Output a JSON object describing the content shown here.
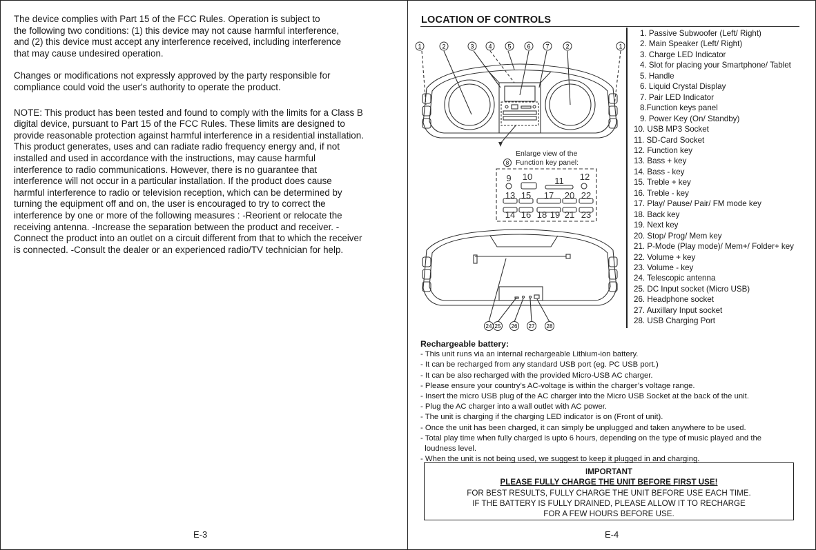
{
  "left_page": {
    "paragraphs": [
      "The device complies with Part 15 of the FCC Rules. Operation is subject to\nthe following two conditions: (1) this device may not cause harmful interference,\nand (2) this device must accept any interference received, including interference\nthat may cause undesired operation.",
      "Changes or modifications not expressly approved by the party responsible for\ncompliance could void the user's authority to operate the product.",
      "NOTE: This product has been tested and found to comply with the limits for a Class B\ndigital device, pursuant to Part 15 of the FCC Rules. These limits are designed to\nprovide reasonable protection against harmful interference in a residential installation.\nThis product generates, uses and can radiate radio frequency energy and, if not\ninstalled and used in accordance with the instructions, may cause harmful\ninterference to radio communications. However, there is no guarantee that\ninterference will not occur in a particular installation. If the product does cause\nharmful interference to radio or television reception, which can be determined by\nturning the equipment off and on, the user is encouraged to try to correct the\ninterference by one or more of the following measures : -Reorient or relocate the\nreceiving antenna. -Increase the separation between the product and receiver. -\nConnect the product into an outlet on a circuit different from that to which the receiver\nis connected. -Consult the dealer or an experienced radio/TV technician for help."
    ],
    "page_number": "E-3"
  },
  "right_page": {
    "title": "LOCATION OF CONTROLS",
    "front_callouts": [
      "1",
      "2",
      "3",
      "4",
      "5",
      "6",
      "7",
      "2",
      "1"
    ],
    "enlarge_caption_line1": "Enlarge view of the",
    "enlarge_caption_line2": "Function key panel:",
    "enlarge_callout": "8",
    "panel_labels": {
      "top": [
        "9",
        "10",
        "11",
        "12"
      ],
      "middle": [
        "13",
        "15",
        "17",
        "20",
        "22"
      ],
      "bottom": [
        "14",
        "16",
        "18",
        "19",
        "21",
        "23"
      ]
    },
    "back_callouts": [
      "24",
      "25",
      "26",
      "27",
      "28"
    ],
    "legend": [
      "1. Passive Subwoofer (Left/ Right)",
      "2. Main Speaker (Left/ Right)",
      "3. Charge LED Indicator",
      "4. Slot for placing your Smartphone/ Tablet",
      "5. Handle",
      "6. Liquid Crystal Display",
      "7. Pair LED Indicator",
      "8.Function keys panel",
      "9. Power Key (On/ Standby)",
      "10. USB MP3 Socket",
      "11. SD-Card Socket",
      "12. Function key",
      "13. Bass + key",
      "14. Bass - key",
      "15. Treble + key",
      "16. Treble - key",
      "17. Play/ Pause/ Pair/ FM mode key",
      "18. Back key",
      "19. Next key",
      "20. Stop/ Prog/ Mem key",
      "21. P-Mode (Play mode)/ Mem+/ Folder+ key",
      "22. Volume + key",
      "23. Volume - key",
      "24. Telescopic antenna",
      "25. DC Input socket (Micro USB)",
      "26. Headphone socket",
      "27. Auxillary Input socket",
      "28. USB Charging Port"
    ],
    "battery": {
      "heading": "Rechargeable battery:",
      "items": [
        "- This unit runs via an internal rechargeable Lithium-ion battery.",
        "- It can be recharged from any standard USB port (eg. PC USB port.)",
        "- It can be also recharged with the provided Micro-USB AC charger.",
        "- Please ensure your country’s AC-voltage is within the charger’s voltage range.",
        "- Insert the micro USB plug of the AC charger into the Micro USB Socket at the back of the unit.",
        "- Plug the AC charger into a wall outlet with AC power.",
        "- The unit is charging if the charging LED indicator is on (Front of unit).",
        "- Once the unit has been charged, it can simply be unplugged and taken anywhere to be used.",
        "- Total play time when fully charged is upto 6 hours, depending on the type of music played and the",
        "  loudness level.",
        "- When the unit is not being used, we suggest to keep it plugged in and charging."
      ]
    },
    "important": {
      "title": "IMPORTANT",
      "subtitle": "PLEASE FULLY CHARGE THE UNIT BEFORE FIRST USE!",
      "line1": "FOR BEST RESULTS, FULLY CHARGE THE UNIT BEFORE USE EACH TIME.",
      "line2": "IF THE BATTERY IS FULLY DRAINED, PLEASE ALLOW IT TO RECHARGE",
      "line3": "FOR A FEW HOURS BEFORE USE."
    },
    "page_number": "E-4"
  }
}
